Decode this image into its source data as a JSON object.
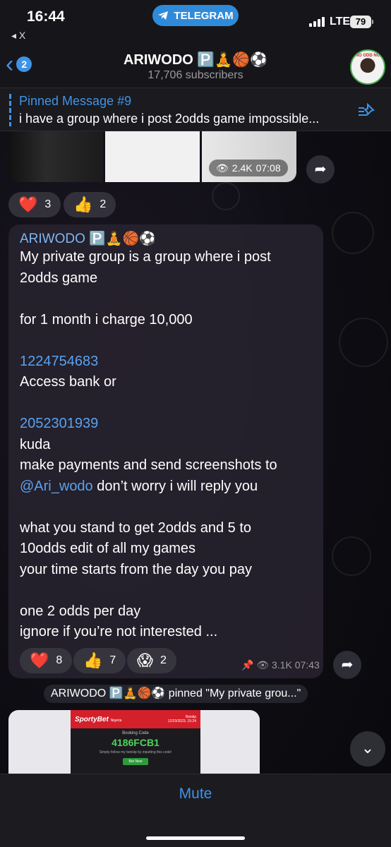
{
  "status_bar": {
    "time": "16:44",
    "app_pill": "TELEGRAM",
    "back_to": "◂ X",
    "network": "LTE",
    "battery": "79"
  },
  "header": {
    "back_count": "2",
    "title": "ARIWODO 🅿️🧘🏀⚽️",
    "subscribers": "17,706 subscribers",
    "avatar_text": "NO ODD NO"
  },
  "pinned": {
    "title": "Pinned Message #9",
    "text": "i have a group where i post 2odds game impossible..."
  },
  "top_media": {
    "views": "2.4K",
    "time": "07:08"
  },
  "top_reactions": [
    {
      "emoji": "❤️",
      "count": "3"
    },
    {
      "emoji": "👍",
      "count": "2"
    }
  ],
  "message": {
    "sender": "ARIWODO 🅿️🧘🏀⚽️",
    "lines": [
      "My private group is a group where i post",
      "2odds game",
      "",
      "for 1 month i charge 10,000",
      "",
      "1224754683",
      "Access bank  or",
      "",
      "2052301939",
      "kuda",
      "make payments and send screenshots to",
      "@Ari_wodo don’t worry i will reply you",
      "",
      "what you stand to get 2odds and 5 to",
      "10odds edit of all my games",
      "your time starts from the day you pay",
      "",
      "one 2 odds per day",
      "ignore if you’re not interested ..."
    ],
    "link_1": "1224754683",
    "link_2": "2052301939",
    "mention": "@Ari_wodo",
    "mention_rest": " don’t worry i will reply you",
    "reactions": [
      {
        "emoji": "❤️",
        "count": "8"
      },
      {
        "emoji": "👍",
        "count": "7"
      },
      {
        "emoji": "😱",
        "count": "2"
      }
    ],
    "views": "3.1K",
    "time": "07:43"
  },
  "service": {
    "text": "ARIWODO 🅿️🧘🏀⚽️ pinned \"My private grou...\""
  },
  "bottom_media": {
    "brand": "SportyBet",
    "country": "Nigeria",
    "meta_1": "Betslip",
    "meta_2": "12/23/2023, 15:24",
    "label": "Booking Code",
    "code": "4186FCB1",
    "note": "Simply follow my betslip by inputting this code!",
    "button": "Bet Now"
  },
  "bottom_bar": {
    "mute": "Mute"
  }
}
